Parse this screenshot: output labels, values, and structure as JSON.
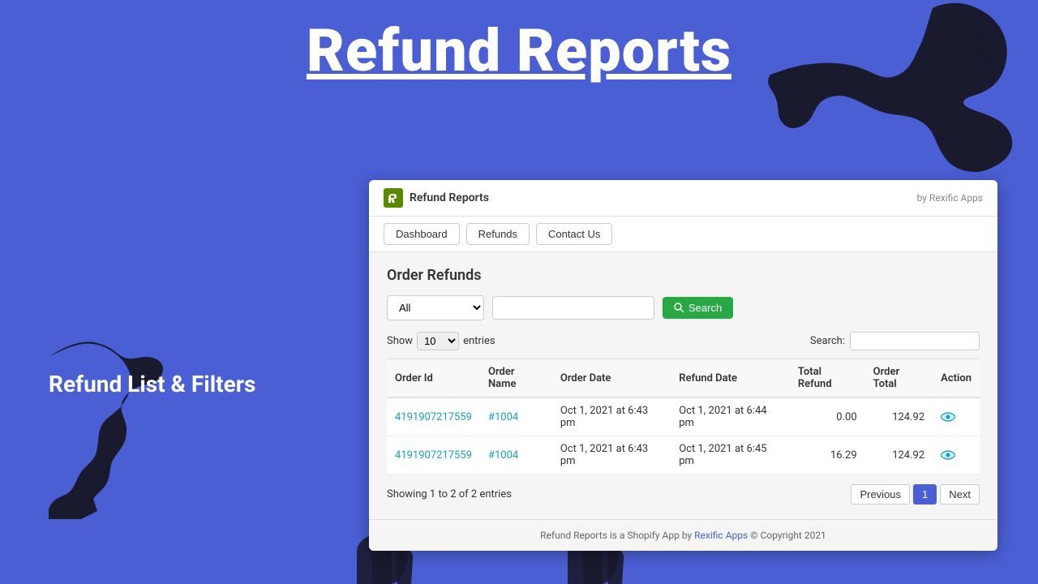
{
  "page": {
    "bg_title": "Refund Reports",
    "side_text": "Refund List & Filters",
    "by_label": "by Rexific Apps"
  },
  "app": {
    "title": "Refund Reports",
    "logo_alt": "rexific-logo"
  },
  "nav": {
    "tabs": [
      {
        "label": "Dashboard",
        "id": "dashboard"
      },
      {
        "label": "Refunds",
        "id": "refunds"
      },
      {
        "label": "Contact Us",
        "id": "contact"
      }
    ]
  },
  "main": {
    "section_title": "Order Refunds",
    "filter": {
      "select_default": "All",
      "search_placeholder": "",
      "search_btn_label": "Search"
    },
    "entries": {
      "show_label": "Show",
      "count": "10",
      "entries_label": "entries",
      "search_label": "Search:"
    },
    "table": {
      "columns": [
        "Order Id",
        "Order Name",
        "Order Date",
        "Refund Date",
        "Total Refund",
        "Order Total",
        "Action"
      ],
      "rows": [
        {
          "order_id": "4191907217559",
          "order_name": "#1004",
          "order_date": "Oct 1, 2021 at 6:43 pm",
          "refund_date": "Oct 1, 2021 at 6:44 pm",
          "total_refund": "0.00",
          "order_total": "124.92"
        },
        {
          "order_id": "4191907217559",
          "order_name": "#1004",
          "order_date": "Oct 1, 2021 at 6:43 pm",
          "refund_date": "Oct 1, 2021 at 6:45 pm",
          "total_refund": "16.29",
          "order_total": "124.92"
        }
      ]
    },
    "pagination": {
      "showing_text": "Showing 1 to 2 of 2 entries",
      "previous_label": "Previous",
      "current_page": "1",
      "next_label": "Next"
    }
  },
  "footer": {
    "text_before": "Refund Reports is a Shopify App by ",
    "link_text": "Rexific Apps",
    "text_after": " © Copyright 2021"
  }
}
